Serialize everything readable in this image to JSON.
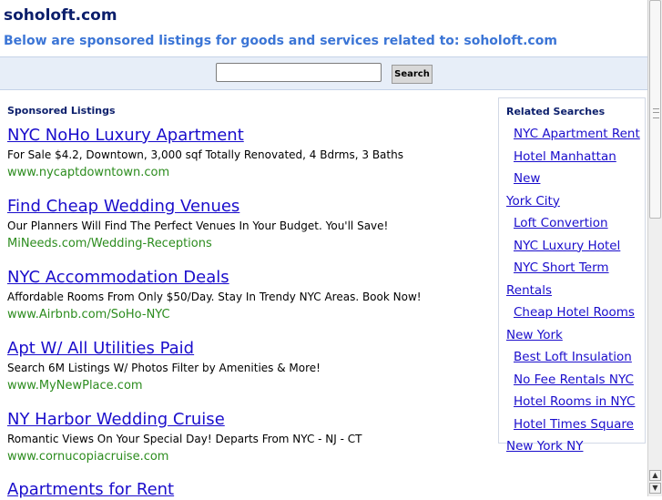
{
  "header": {
    "site_title": "soholoft.com",
    "tagline": "Below are sponsored listings for goods and services related to: soholoft.com"
  },
  "search": {
    "button_label": "Search",
    "value": ""
  },
  "listings": {
    "heading": "Sponsored Listings",
    "items": [
      {
        "title": "NYC NoHo Luxury Apartment",
        "description": "For Sale $4.2, Downtown, 3,000 sqf Totally Renovated, 4 Bdrms, 3 Baths",
        "url": "www.nycaptdowntown.com"
      },
      {
        "title": "Find Cheap Wedding Venues",
        "description": "Our Planners Will Find The Perfect Venues In Your Budget. You'll Save!",
        "url": "MiNeeds.com/Wedding-Receptions"
      },
      {
        "title": "NYC Accommodation Deals",
        "description": "Affordable Rooms From Only $50/Day. Stay In Trendy NYC Areas. Book Now!",
        "url": "www.Airbnb.com/SoHo-NYC"
      },
      {
        "title": "Apt W/ All Utilities Paid",
        "description": "Search 6M Listings W/ Photos Filter by Amenities & More!",
        "url": "www.MyNewPlace.com"
      },
      {
        "title": "NY Harbor Wedding Cruise",
        "description": "Romantic Views On Your Special Day! Departs From NYC - NJ - CT",
        "url": "www.cornucopiacruise.com"
      },
      {
        "title": "Apartments for Rent",
        "description": "",
        "url": ""
      }
    ]
  },
  "related": {
    "heading": "Related Searches",
    "items": [
      {
        "first": "NYC Apartment Rent",
        "second": ""
      },
      {
        "first": "Hotel Manhattan New",
        "second": "York City"
      },
      {
        "first": "Loft Convertion",
        "second": ""
      },
      {
        "first": "NYC Luxury Hotel",
        "second": ""
      },
      {
        "first": "NYC Short Term",
        "second": "Rentals"
      },
      {
        "first": "Cheap Hotel Rooms",
        "second": "New York"
      },
      {
        "first": "Best Loft Insulation",
        "second": ""
      },
      {
        "first": "No Fee Rentals NYC",
        "second": ""
      },
      {
        "first": "Hotel Rooms in NYC",
        "second": ""
      },
      {
        "first": "Hotel Times Square",
        "second": "New York NY"
      }
    ]
  },
  "colors": {
    "title_navy": "#0b1e6b",
    "tagline_blue": "#3b75d6",
    "link_blue": "#1a0dcc",
    "url_green": "#2c8c1e",
    "search_bar_bg": "#e7eef8"
  },
  "icons": {
    "scroll_up": "triangle-up",
    "scroll_down": "triangle-down"
  }
}
